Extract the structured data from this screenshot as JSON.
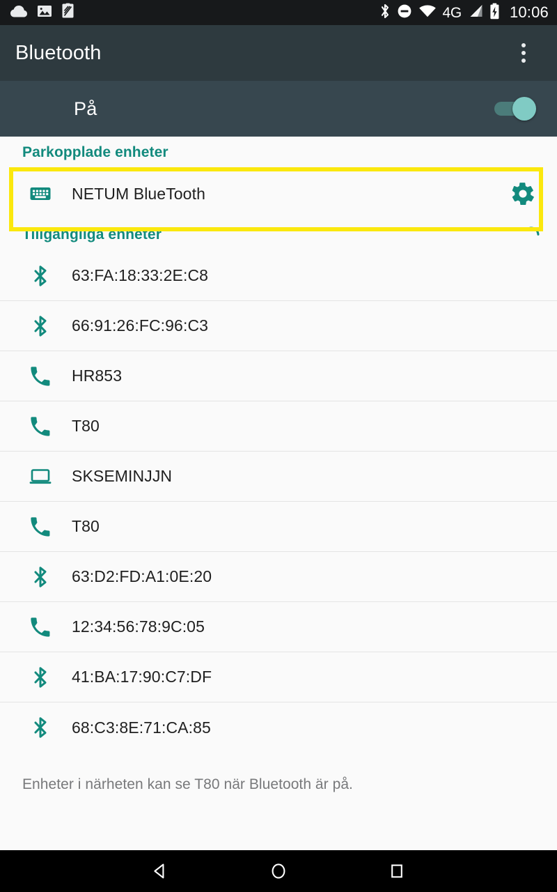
{
  "status_bar": {
    "left_icons": [
      "cloud-icon",
      "photo-icon",
      "screenshot-icon"
    ],
    "right_icons": [
      "bluetooth-icon",
      "do-not-disturb-icon",
      "wifi-icon",
      "mobile-signal-icon",
      "battery-charging-icon"
    ],
    "network_label": "4G",
    "clock": "10:06",
    "background_color": "#17191b"
  },
  "app_bar": {
    "title": "Bluetooth",
    "overflow_icon": "more-vert-icon",
    "background_color": "#2e3a3f"
  },
  "master_switch": {
    "label": "På",
    "state": "on",
    "track_color": "#4b7c7a",
    "thumb_color": "#80cbc4",
    "background_color": "#37474f"
  },
  "accent_color": "#128a7d",
  "highlight_color": "#fbe80d",
  "paired_section": {
    "header": "Parkopplade enheter",
    "devices": [
      {
        "name": "NETUM BlueTooth",
        "icon": "keyboard-icon",
        "settings_icon": "gear-icon",
        "highlighted": true
      }
    ]
  },
  "available_section": {
    "header": "Tillgängliga enheter",
    "scanning": true,
    "scan_icon": "scanning-spinner-icon",
    "devices": [
      {
        "name": "63:FA:18:33:2E:C8",
        "icon": "bluetooth-icon"
      },
      {
        "name": "66:91:26:FC:96:C3",
        "icon": "bluetooth-icon"
      },
      {
        "name": "HR853",
        "icon": "phone-icon"
      },
      {
        "name": "T80",
        "icon": "phone-icon"
      },
      {
        "name": "SKSEMINJJN",
        "icon": "laptop-icon"
      },
      {
        "name": "T80",
        "icon": "phone-icon"
      },
      {
        "name": "63:D2:FD:A1:0E:20",
        "icon": "bluetooth-icon"
      },
      {
        "name": "12:34:56:78:9C:05",
        "icon": "phone-icon"
      },
      {
        "name": "41:BA:17:90:C7:DF",
        "icon": "bluetooth-icon"
      },
      {
        "name": "68:C3:8E:71:CA:85",
        "icon": "bluetooth-icon"
      }
    ]
  },
  "footer_note": "Enheter i närheten kan se T80 när Bluetooth är på.",
  "nav_bar": {
    "back_icon": "back-triangle-icon",
    "home_icon": "home-circle-icon",
    "recents_icon": "recents-square-icon",
    "background_color": "#000000"
  }
}
